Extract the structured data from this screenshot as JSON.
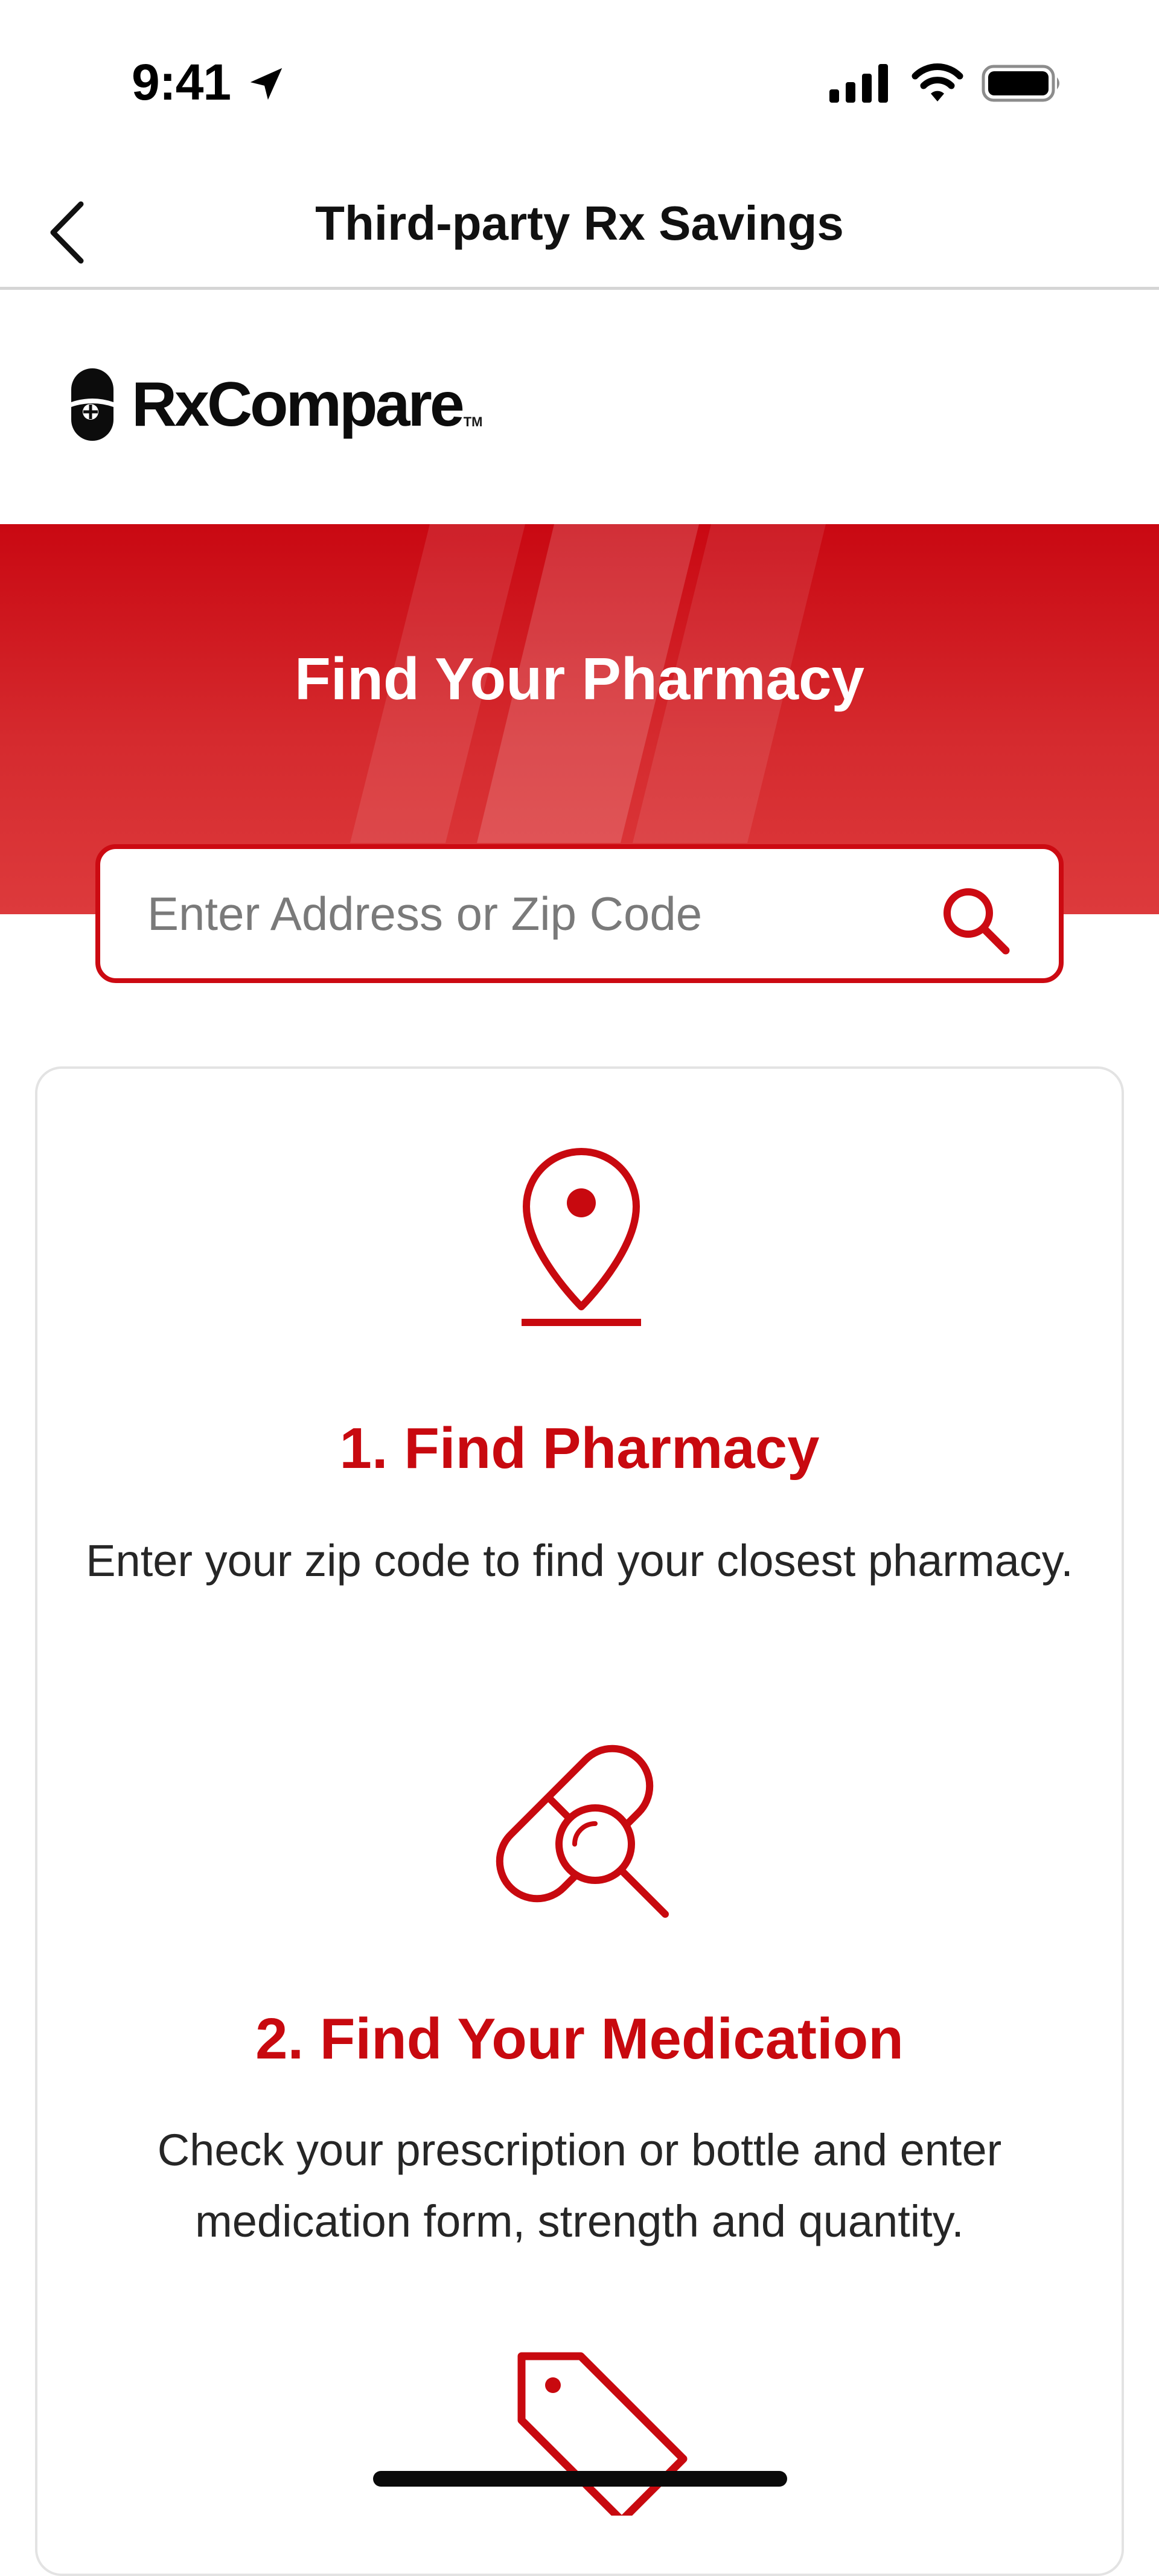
{
  "status_bar": {
    "time": "9:41"
  },
  "nav": {
    "title": "Third-party Rx Savings"
  },
  "logo": {
    "text": "RxCompare",
    "tm": "TM"
  },
  "hero": {
    "title": "Find Your Pharmacy"
  },
  "search": {
    "placeholder": "Enter Address or Zip Code",
    "value": ""
  },
  "steps": [
    {
      "title": "1. Find Pharmacy",
      "description": "Enter your zip code to find your closest pharmacy.",
      "icon": "location-pin-icon"
    },
    {
      "title": "2. Find Your Medication",
      "description": "Check your prescription or bottle and enter medication form, strength and quantity.",
      "icon": "pill-search-icon"
    },
    {
      "icon": "price-tag-icon"
    }
  ],
  "colors": {
    "brand_red": "#cc0a12",
    "hero_gradient_top": "#c90812",
    "hero_gradient_bottom": "#dd3a3c",
    "text_dark": "#1a1a1a"
  }
}
